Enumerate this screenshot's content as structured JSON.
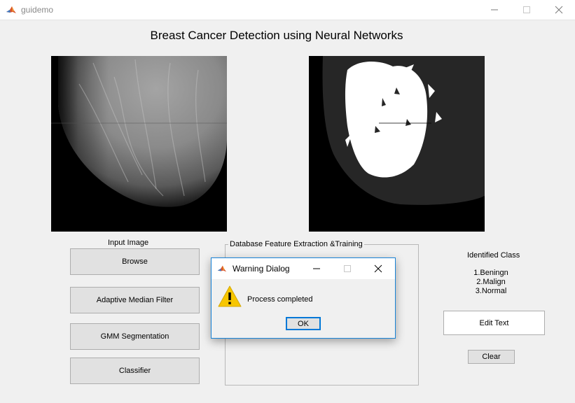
{
  "window": {
    "title": "guidemo"
  },
  "main_title": "Breast Cancer Detection using Neural Networks",
  "input_panel": {
    "label": "Input Image"
  },
  "buttons": {
    "browse": "Browse",
    "median_filter": "Adaptive Median Filter",
    "gmm": "GMM Segmentation",
    "classifier": "Classifier",
    "clear": "Clear"
  },
  "feature_group": {
    "title": "Database Feature Extraction &Training"
  },
  "identified": {
    "label": "Identified Class",
    "classes": [
      "1.Beningn",
      "2.Malign",
      "3.Normal"
    ]
  },
  "result_field": {
    "value": "Edit Text"
  },
  "dialog": {
    "title": "Warning Dialog",
    "message": "Process completed",
    "ok_label": "OK"
  },
  "icons": {
    "app": "matlab-icon",
    "warning": "warning-triangle-icon",
    "accent": "#0078d7",
    "warning_color": "#f7c600"
  }
}
